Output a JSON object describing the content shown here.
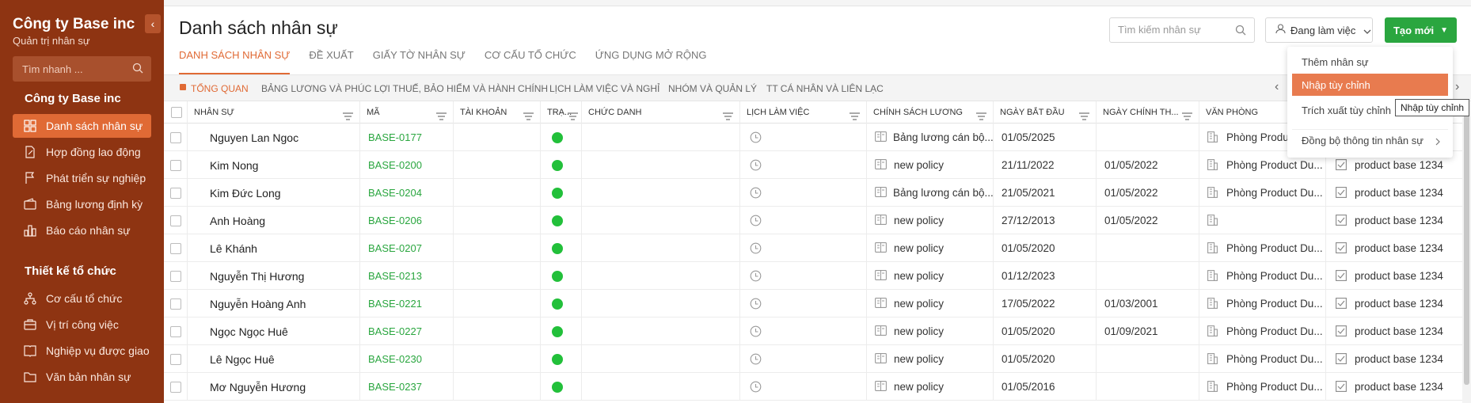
{
  "sidebar": {
    "company": "Công ty Base inc",
    "subtitle": "Quản trị nhân sự",
    "collapse_icon": "‹",
    "search_placeholder": "Tìm nhanh ...",
    "section1_title": "Công ty Base inc",
    "section1_items": [
      {
        "label": "Danh sách nhân sự",
        "icon": "grid-icon",
        "active": true
      },
      {
        "label": "Hợp đồng lao động",
        "icon": "contract-icon",
        "active": false
      },
      {
        "label": "Phát triển sự nghiệp",
        "icon": "flag-icon",
        "active": false
      },
      {
        "label": "Bảng lương định kỳ",
        "icon": "wallet-icon",
        "active": false
      },
      {
        "label": "Báo cáo nhân sự",
        "icon": "bar-chart-icon",
        "active": false
      }
    ],
    "section2_title": "Thiết kế tổ chức",
    "section2_items": [
      {
        "label": "Cơ cấu tổ chức",
        "icon": "org-chart-icon"
      },
      {
        "label": "Vị trí công việc",
        "icon": "briefcase-icon"
      },
      {
        "label": "Nghiệp vụ được giao",
        "icon": "book-icon"
      },
      {
        "label": "Văn bản nhân sự",
        "icon": "folder-icon"
      }
    ]
  },
  "header": {
    "title": "Danh sách nhân sự",
    "search_placeholder": "Tìm kiếm nhân sự",
    "status_label": "Đang làm việc",
    "create_label": "Tạo mới"
  },
  "tabs": [
    {
      "label": "DANH SÁCH NHÂN SỰ",
      "active": true
    },
    {
      "label": "ĐỀ XUẤT",
      "active": false
    },
    {
      "label": "GIẤY TỜ NHÂN SỰ",
      "active": false
    },
    {
      "label": "CƠ CẤU TỔ CHỨC",
      "active": false
    },
    {
      "label": "ỨNG DỤNG MỞ RỘNG",
      "active": false
    }
  ],
  "subtabs": [
    {
      "label": "TỔNG QUAN",
      "active": true
    },
    {
      "label": "BẢNG LƯƠNG VÀ PHÚC LỢI",
      "active": false
    },
    {
      "label": "THUẾ, BẢO HIỂM VÀ HÀNH CHÍNH",
      "active": false
    },
    {
      "label": "LỊCH LÀM VIỆC VÀ NGHỈ",
      "active": false
    },
    {
      "label": "NHÓM VÀ QUẢN LÝ",
      "active": false
    },
    {
      "label": "TT CÁ NHÂN VÀ LIÊN LẠC",
      "active": false
    }
  ],
  "columns": [
    "NHÂN SỰ",
    "MÃ",
    "TÀI KHOẢN",
    "TRẠ...",
    "CHỨC DANH",
    "LỊCH LÀM VIỆC",
    "CHÍNH SÁCH LƯƠNG",
    "NGÀY BẮT ĐẦU",
    "NGÀY CHÍNH TH...",
    "VĂN PHÒNG"
  ],
  "rows": [
    {
      "name": "Nguyen Lan Ngoc",
      "code": "BASE-0177",
      "policy": "Bảng lương cán bộ...",
      "start": "01/05/2025",
      "official": "",
      "office": "Phòng Product",
      "extra": ""
    },
    {
      "name": "Kim Nong",
      "code": "BASE-0200",
      "policy": "new policy",
      "start": "21/11/2022",
      "official": "01/05/2022",
      "office": "Phòng Product Du...",
      "extra": "product base 1234"
    },
    {
      "name": "Kim Đức Long",
      "code": "BASE-0204",
      "policy": "Bảng lương cán bộ...",
      "start": "21/05/2021",
      "official": "01/05/2022",
      "office": "Phòng Product Du...",
      "extra": "product base 1234"
    },
    {
      "name": "Anh Hoàng",
      "code": "BASE-0206",
      "policy": "new policy",
      "start": "27/12/2013",
      "official": "01/05/2022",
      "office": "",
      "extra": "product base 1234"
    },
    {
      "name": "Lê Khánh",
      "code": "BASE-0207",
      "policy": "new policy",
      "start": "01/05/2020",
      "official": "",
      "office": "Phòng Product Du...",
      "extra": "product base 1234"
    },
    {
      "name": "Nguyễn Thị Hương",
      "code": "BASE-0213",
      "policy": "new policy",
      "start": "01/12/2023",
      "official": "",
      "office": "Phòng Product Du...",
      "extra": "product base 1234"
    },
    {
      "name": "Nguyễn Hoàng Anh",
      "code": "BASE-0221",
      "policy": "new policy",
      "start": "17/05/2022",
      "official": "01/03/2001",
      "office": "Phòng Product Du...",
      "extra": "product base 1234"
    },
    {
      "name": "Ngọc Ngọc Huê",
      "code": "BASE-0227",
      "policy": "new policy",
      "start": "01/05/2020",
      "official": "01/09/2021",
      "office": "Phòng Product Du...",
      "extra": "product base 1234"
    },
    {
      "name": "Lê Ngọc Huê",
      "code": "BASE-0230",
      "policy": "new policy",
      "start": "01/05/2020",
      "official": "",
      "office": "Phòng Product Du...",
      "extra": "product base 1234"
    },
    {
      "name": "Mơ Nguyễn Hương",
      "code": "BASE-0237",
      "policy": "new policy",
      "start": "01/05/2016",
      "official": "",
      "office": "Phòng Product Du...",
      "extra": "product base 1234"
    }
  ],
  "menu": {
    "items": [
      {
        "label": "Thêm nhân sự",
        "active": false
      },
      {
        "label": "Nhập tùy chỉnh",
        "active": true
      },
      {
        "label": "Trích xuất tùy chỉnh",
        "active": false
      },
      {
        "label": "Đồng bộ thông tin nhân sự",
        "active": false
      }
    ],
    "tooltip": "Nhập tùy chỉnh"
  },
  "colors": {
    "sidebar": "#8e3412",
    "accent": "#e06a35",
    "green": "#2aa63f",
    "status_dot": "#22c03a"
  }
}
